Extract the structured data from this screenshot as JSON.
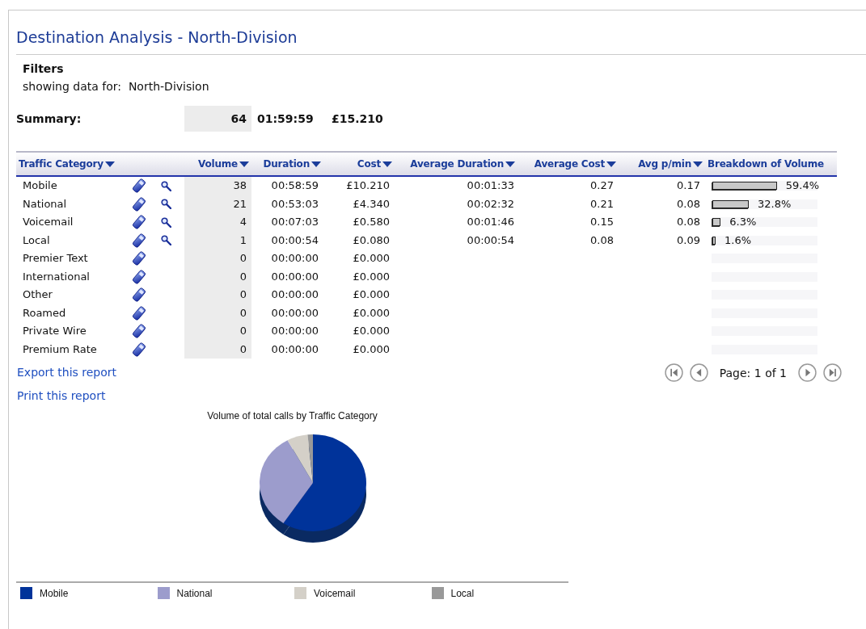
{
  "title": "Destination Analysis - North-Division",
  "filters": {
    "heading": "Filters",
    "label": "showing data for:",
    "value": "North-Division"
  },
  "summary": {
    "label": "Summary:",
    "volume": "64",
    "duration": "01:59:59",
    "cost": "£15.210"
  },
  "table": {
    "columns": [
      {
        "label": "Traffic Category",
        "sortable": true
      },
      {
        "label": "Volume",
        "sortable": true
      },
      {
        "label": "Duration",
        "sortable": true
      },
      {
        "label": "Cost",
        "sortable": true
      },
      {
        "label": "Average Duration",
        "sortable": true
      },
      {
        "label": "Average Cost",
        "sortable": true
      },
      {
        "label": "Avg p/min",
        "sortable": true
      },
      {
        "label": "Breakdown of Volume",
        "sortable": false
      }
    ],
    "rows": [
      {
        "category": "Mobile",
        "details": true,
        "volume": "38",
        "duration": "00:58:59",
        "cost": "£10.210",
        "avg_duration": "00:01:33",
        "avg_cost": "0.27",
        "avg_ppm": "0.17",
        "level": 0.594,
        "share": "59.4%"
      },
      {
        "category": "National",
        "details": true,
        "volume": "21",
        "duration": "00:53:03",
        "cost": "£4.340",
        "avg_duration": "00:02:32",
        "avg_cost": "0.21",
        "avg_ppm": "0.08",
        "level": 0.328,
        "share": "32.8%"
      },
      {
        "category": "Voicemail",
        "details": true,
        "volume": "4",
        "duration": "00:07:03",
        "cost": "£0.580",
        "avg_duration": "00:01:46",
        "avg_cost": "0.15",
        "avg_ppm": "0.08",
        "level": 0.063,
        "share": "6.3%"
      },
      {
        "category": "Local",
        "details": true,
        "volume": "1",
        "duration": "00:00:54",
        "cost": "£0.080",
        "avg_duration": "00:00:54",
        "avg_cost": "0.08",
        "avg_ppm": "0.09",
        "level": 0.016,
        "share": "1.6%"
      },
      {
        "category": "Premier Text",
        "details": false,
        "volume": "0",
        "duration": "00:00:00",
        "cost": "£0.000",
        "level": 0
      },
      {
        "category": "International",
        "details": false,
        "volume": "0",
        "duration": "00:00:00",
        "cost": "£0.000",
        "level": 0
      },
      {
        "category": "Other",
        "details": false,
        "volume": "0",
        "duration": "00:00:00",
        "cost": "£0.000",
        "level": 0
      },
      {
        "category": "Roamed",
        "details": false,
        "volume": "0",
        "duration": "00:00:00",
        "cost": "£0.000",
        "level": 0
      },
      {
        "category": "Private Wire",
        "details": false,
        "volume": "0",
        "duration": "00:00:00",
        "cost": "£0.000",
        "level": 0
      },
      {
        "category": "Premium Rate",
        "details": false,
        "volume": "0",
        "duration": "00:00:00",
        "cost": "£0.000",
        "level": 0
      }
    ]
  },
  "links": [
    "Export this report",
    "Print this report"
  ],
  "pager": {
    "text": "Page: 1 of 1"
  },
  "chart": {
    "chart_data": {
      "type": "pie",
      "title": "Volume of total calls by Traffic Category",
      "series": [
        {
          "values": [
            59.4,
            32.8,
            6.3,
            1.6
          ]
        }
      ]
    },
    "legend": [
      {
        "label": "Mobile",
        "color": "#00339a"
      },
      {
        "label": "National",
        "color": "#9c9ccc"
      },
      {
        "label": "Voicemail",
        "color": "#d4d0c8"
      },
      {
        "label": "Local",
        "color": "#999999"
      }
    ]
  }
}
